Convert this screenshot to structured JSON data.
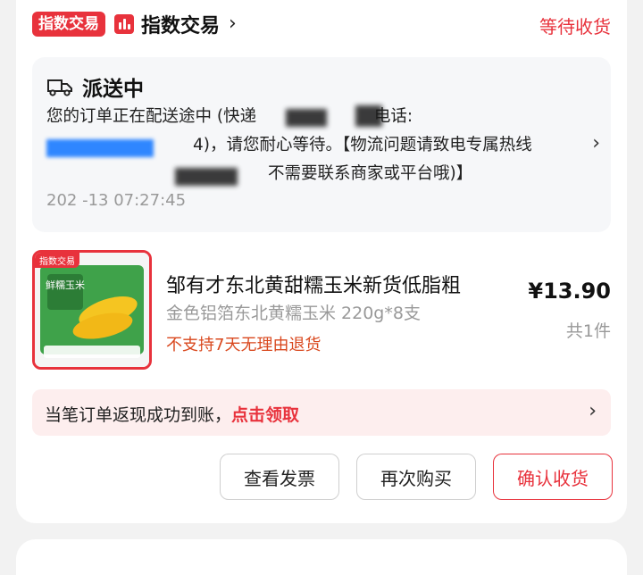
{
  "shop": {
    "badge": "指数交易",
    "name": "指数交易",
    "chevron": "›"
  },
  "order": {
    "status": "等待收货"
  },
  "logistics": {
    "title": "派送中",
    "line1_a": "您的订单正在配送途中 (快递",
    "line1_b": "电话:",
    "line2_a": "4)，请您耐心等待。【物流问题请致电专属热线",
    "line3_a": "不需要联系商家或平台哦)】",
    "time": "202  -13 07:27:45",
    "arrow": "›"
  },
  "product": {
    "thumb_tag": "指数交易",
    "title": "邹有才东北黄甜糯玉米新货低脂粗",
    "spec": "金色铝箔东北黄糯玉米 220g*8支",
    "note": "不支持7天无理由退货",
    "price": "¥13.90",
    "qty": "共1件",
    "package_text": "鲜糯玉米"
  },
  "cashback": {
    "text": "当笔订单返现成功到账，",
    "link": "点击领取",
    "arrow": "›"
  },
  "actions": {
    "invoice": "查看发票",
    "rebuy": "再次购买",
    "confirm": "确认收货"
  },
  "colors": {
    "accent": "#e8323c",
    "warning": "#d9481e",
    "muted": "#999999"
  }
}
